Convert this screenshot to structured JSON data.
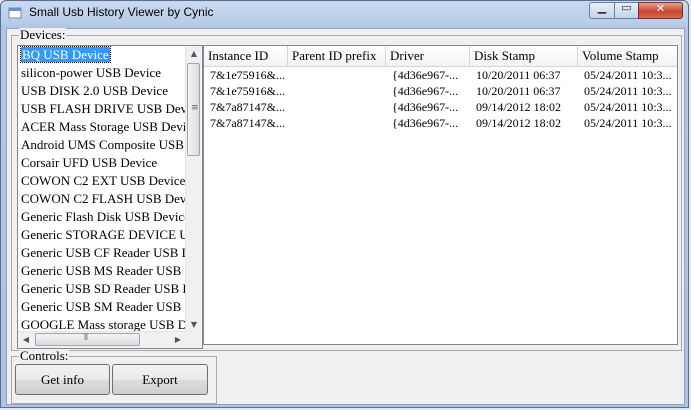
{
  "window": {
    "title": "Small Usb History Viewer by Cynic"
  },
  "devices_group": {
    "label": "Devices:"
  },
  "controls_group": {
    "label": "Controls:"
  },
  "devices": [
    "BQ USB Device",
    "silicon-power USB Device",
    "USB DISK 2.0 USB Device",
    "USB FLASH DRIVE USB Device",
    "ACER Mass Storage USB Device",
    "Android  UMS Composite USB Device",
    "Corsair UFD USB Device",
    "COWON C2 EXT USB Device",
    "COWON C2 FLASH USB Device",
    "Generic Flash Disk USB Device",
    "Generic STORAGE DEVICE USB Device",
    "Generic USB CF Reader USB Device",
    "Generic USB MS Reader USB Device",
    "Generic USB SD Reader USB Device",
    "Generic USB SM Reader USB Device",
    "GOOGLE Mass storage USB Device"
  ],
  "selected_device_index": 0,
  "table": {
    "columns": [
      "Instance ID",
      "Parent ID prefix",
      "Driver",
      "Disk Stamp",
      "Volume Stamp"
    ],
    "rows": [
      [
        "7&1e75916&...",
        "",
        "{4d36e967-...",
        "10/20/2011 06:37",
        "05/24/2011 10:3..."
      ],
      [
        "7&1e75916&...",
        "",
        "{4d36e967-...",
        "10/20/2011 06:37",
        "05/24/2011 10:3..."
      ],
      [
        "7&7a87147&...",
        "",
        "{4d36e967-...",
        "09/14/2012 18:02",
        "05/24/2011 10:3..."
      ],
      [
        "7&7a87147&...",
        "",
        "{4d36e967-...",
        "09/14/2012 18:02",
        "05/24/2011 10:3..."
      ]
    ]
  },
  "buttons": {
    "get_info": "Get info",
    "export": "Export"
  },
  "icons": {
    "app": "usb-app-icon",
    "minimize": "minimize-icon",
    "maximize": "maximize-icon",
    "close": "close-icon"
  },
  "colors": {
    "selection": "#3399ff",
    "close_button": "#c9442c"
  }
}
